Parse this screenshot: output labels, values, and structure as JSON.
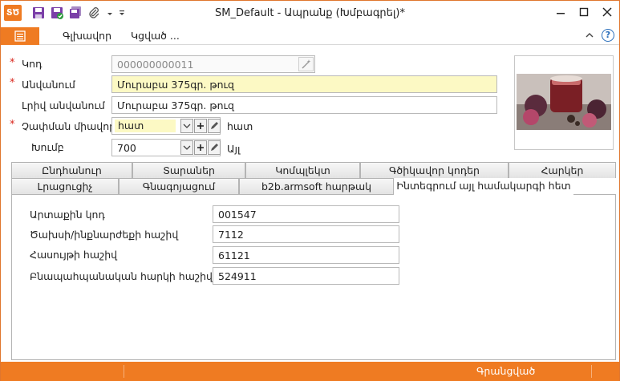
{
  "window": {
    "title": "SM_Default - Ապրանք (Խմբագրել)*",
    "app_icon_text": "ՏԾ"
  },
  "ribbon": {
    "tabs": [
      "Գլխավոր",
      "Կցված ..."
    ]
  },
  "form": {
    "code": {
      "label": "Կոդ",
      "value": "000000000011"
    },
    "name": {
      "label": "Անվանում",
      "value": "Մուրաբա 375գր. թուզ"
    },
    "full_name": {
      "label": "Լրիվ անվանում",
      "value": "Մուրաբա 375գր. թուզ"
    },
    "unit": {
      "label": "Չափման միավոր",
      "value": "հատ",
      "caption": "հատ"
    },
    "group": {
      "label": "Խումբ",
      "value": "700",
      "caption": "Այլ"
    }
  },
  "tabs_row1": [
    "Ընդհանուր",
    "Տարաներ",
    "Կոմպլեկտ",
    "Գծիկավոր կոդեր",
    "Հարկեր"
  ],
  "tabs_row2": [
    "Լրացուցիչ",
    "Գնագոյացում",
    "b2b.armsoft հարթակ",
    "Ինտեգրում այլ համակարգի հետ"
  ],
  "panel": {
    "fields": [
      {
        "label": "Արտաքին կոդ",
        "value": "001547"
      },
      {
        "label": "Ծախսի/ինքնարժեքի հաշիվ",
        "value": "7112"
      },
      {
        "label": "Հասույթի հաշիվ",
        "value": "61121"
      },
      {
        "label": "Բնապահպանական հարկի հաշիվ",
        "value": "524911"
      }
    ]
  },
  "statusbar": {
    "text": "Գրանցված"
  },
  "colors": {
    "accent": "#ef7b22",
    "required": "#d9261c",
    "highlight_field": "#fcf9c4"
  }
}
